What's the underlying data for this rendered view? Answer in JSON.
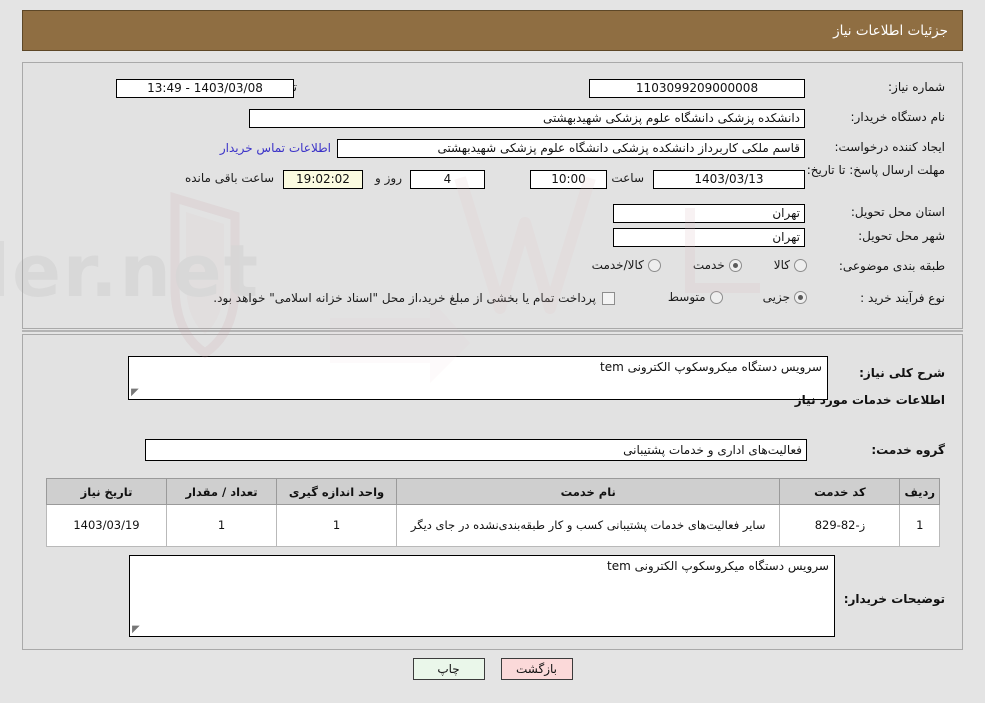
{
  "header": {
    "title": "جزئیات اطلاعات نیاز"
  },
  "form": {
    "need_number": {
      "label": "شماره نیاز:",
      "value": "1103099209000008"
    },
    "announce_datetime": {
      "label": "تاریخ و ساعت اعلان عمومی:",
      "value": "1403/03/08 - 13:49"
    },
    "buyer_org": {
      "label": "نام دستگاه خریدار:",
      "value": "دانشکده پزشکی دانشگاه علوم پزشکی شهیدبهشتی"
    },
    "requester": {
      "label": "ایجاد کننده درخواست:",
      "value": "قاسم ملکی کاربرداز دانشکده پزشکی دانشگاه علوم پزشکی شهیدبهشتی"
    },
    "contact_link": "اطلاعات تماس خریدار",
    "deadline": {
      "label": "مهلت ارسال پاسخ: تا تاریخ:",
      "date": "1403/03/13",
      "hour_label": "ساعت",
      "hour": "10:00",
      "days": "4",
      "days_label": "روز و",
      "countdown": "19:02:02",
      "countdown_label": "ساعت باقی مانده"
    },
    "province": {
      "label": "استان محل تحویل:",
      "value": "تهران"
    },
    "city": {
      "label": "شهر محل تحویل:",
      "value": "تهران"
    },
    "category": {
      "label": "طبقه بندی موضوعی:",
      "options": [
        "کالا",
        "خدمت",
        "کالا/خدمت"
      ],
      "selected": "خدمت"
    },
    "process": {
      "label": "نوع فرآیند خرید :",
      "options": [
        "جزیی",
        "متوسط"
      ],
      "selected": "جزیی",
      "treasury_note": "پرداخت تمام یا بخشی از مبلغ خرید،از محل \"اسناد خزانه اسلامی\" خواهد بود."
    }
  },
  "details": {
    "general_desc": {
      "label": "شرح کلی نیاز:",
      "value": "سرویس دستگاه میکروسکوپ الکترونی tem"
    },
    "services_section_title": "اطلاعات خدمات مورد نیاز",
    "service_group": {
      "label": "گروه خدمت:",
      "value": "فعالیت‌های اداری و خدمات پشتیبانی"
    },
    "buyer_notes": {
      "label": "توضیحات خریدار:",
      "value": "سرویس دستگاه میکروسکوپ الکترونی tem"
    }
  },
  "table": {
    "headers": [
      "ردیف",
      "کد خدمت",
      "نام خدمت",
      "واحد اندازه گیری",
      "تعداد / مقدار",
      "تاریخ نیاز"
    ],
    "rows": [
      {
        "radif": "1",
        "code": "ز-82-829",
        "name": "سایر فعالیت‌های خدمات پشتیبانی کسب و کار طبقه‌بندی‌نشده در جای دیگر",
        "unit": "1",
        "qty": "1",
        "date": "1403/03/19"
      }
    ]
  },
  "buttons": {
    "print": "چاپ",
    "back": "بازگشت"
  },
  "watermark": {
    "text": "AriaTender.net"
  },
  "colors": {
    "header_bg": "#8f6e42",
    "link": "#3b32c8",
    "panel_bg": "#e2e2e2",
    "accent_yellow": "#fbfbe0"
  }
}
